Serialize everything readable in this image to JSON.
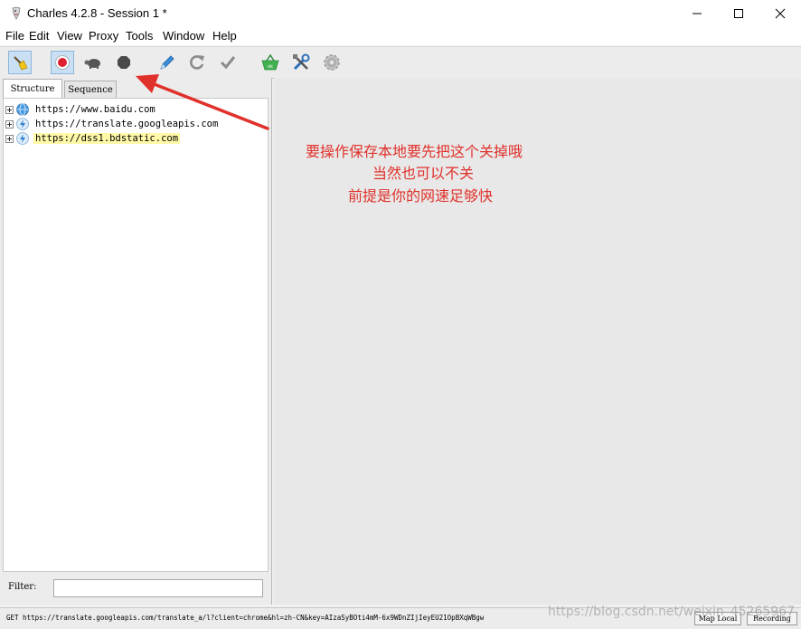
{
  "window": {
    "title": "Charles 4.2.8 - Session 1 *"
  },
  "menu": [
    "File",
    "Edit",
    "View",
    "Proxy",
    "Tools",
    "Window",
    "Help"
  ],
  "toolbar": {
    "icons": [
      "broom-icon",
      "record-icon",
      "turtle-icon",
      "stop-icon",
      "pen-icon",
      "refresh-icon",
      "check-icon",
      "basket-icon",
      "tools-icon",
      "gear-icon"
    ],
    "basket_badge": "ok"
  },
  "tabs": [
    "Structure",
    "Sequence"
  ],
  "tree": [
    {
      "host": "https://www.baidu.com"
    },
    {
      "host": "https://translate.googleapis.com"
    },
    {
      "host": "https://dss1.bdstatic.com"
    }
  ],
  "filter": {
    "label": "Filter:",
    "value": ""
  },
  "annotation": [
    "要操作保存本地要先把这个关掉哦",
    "当然也可以不关",
    "前提是你的网速足够快"
  ],
  "status": {
    "text": "GET https://translate.googleapis.com/translate_a/l?client=chrome&hl=zh-CN&key=AIzaSyBOti4mM-6x9WDnZIjIeyEU21OpBXqWBgw",
    "map_local": "Map Local",
    "recording": "Recording"
  },
  "watermark": "https://blog.csdn.net/weixin_45265967",
  "colors": {
    "annotation": "#e0312b",
    "highlight": "#fff9a8",
    "record": "#e02030"
  }
}
